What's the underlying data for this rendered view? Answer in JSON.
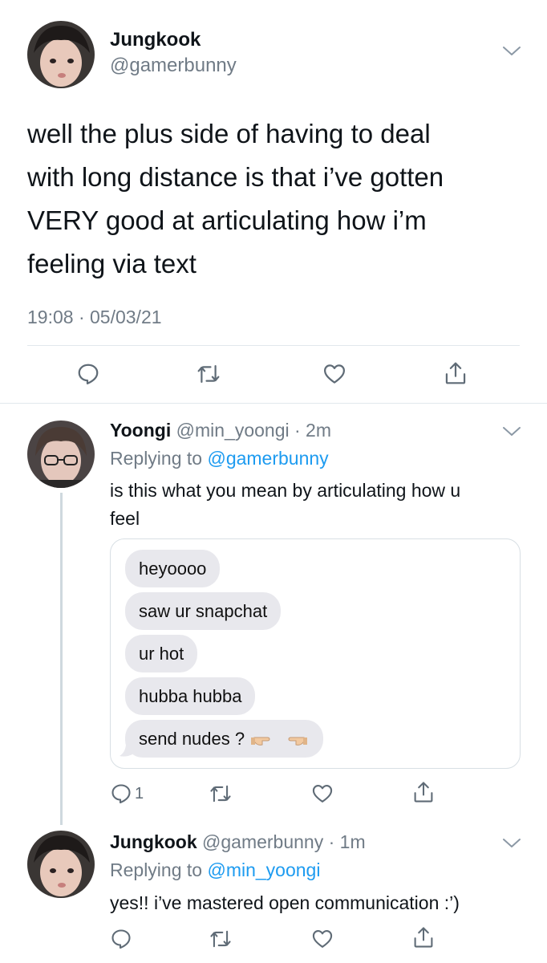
{
  "main_tweet": {
    "display_name": "Jungkook",
    "handle": "@gamerbunny",
    "text_lines": [
      "well the plus side of having to deal",
      "with long distance is that i’ve gotten",
      "VERY good at articulating how i’m",
      "feeling via text"
    ],
    "timestamp": "19:08 · 05/03/21"
  },
  "reply_1": {
    "display_name": "Yoongi",
    "handle": "@min_yoongi",
    "time": "· 2m",
    "replying_prefix": "Replying to",
    "replying_to": "@gamerbunny",
    "text_lines": [
      "is this what you mean by articulating how u",
      "feel"
    ],
    "messages": [
      "heyoooo",
      "saw ur snapchat",
      "ur hot",
      "hubba hubba",
      "send nudes ?"
    ],
    "reply_count": "1"
  },
  "reply_2": {
    "display_name": "Jungkook",
    "handle": "@gamerbunny",
    "time": "· 1m",
    "replying_prefix": "Replying to",
    "replying_to": "@min_yoongi",
    "text": "yes!! i’ve mastered open communication :’)"
  },
  "icons": {
    "reply": "speech-bubble-icon",
    "retweet": "retweet-icon",
    "like": "heart-icon",
    "share": "share-icon",
    "more": "chevron-down-icon"
  },
  "colors": {
    "link": "#1d9bf0",
    "muted": "#707b86",
    "bubble": "#e8e8ed"
  }
}
